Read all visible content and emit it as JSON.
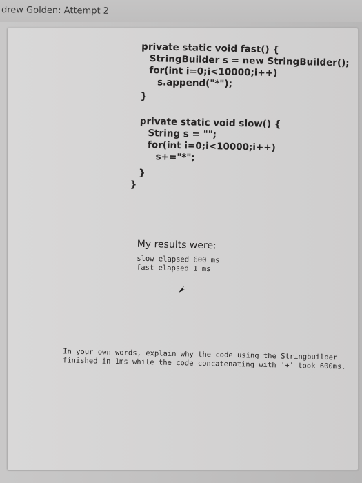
{
  "header": {
    "title": "drew Golden: Attempt 2"
  },
  "code": {
    "fast_signature": "private static void fast() {",
    "fast_line1": "StringBuilder s = new StringBuilder();",
    "fast_line2": "for(int i=0;i<10000;i++)",
    "fast_line3": "s.append(\"*\");",
    "fast_close": "}",
    "slow_signature": "private static void slow() {",
    "slow_line1": "String s = \"\";",
    "slow_line2": "for(int i=0;i<10000;i++)",
    "slow_line3": "s+=\"*\";",
    "slow_inner_close": "}",
    "slow_close": "}"
  },
  "results": {
    "heading": "My results were:",
    "slow_line": "slow elapsed 600 ms",
    "fast_line": "fast elapsed 1 ms"
  },
  "answer": {
    "line1": "In your own words, explain why the code using the Stringbuilder",
    "line2": "finished in 1ms while the code concatenating with '+' took 600ms."
  },
  "icons": {
    "cursor": "mouse-pointer-icon"
  }
}
